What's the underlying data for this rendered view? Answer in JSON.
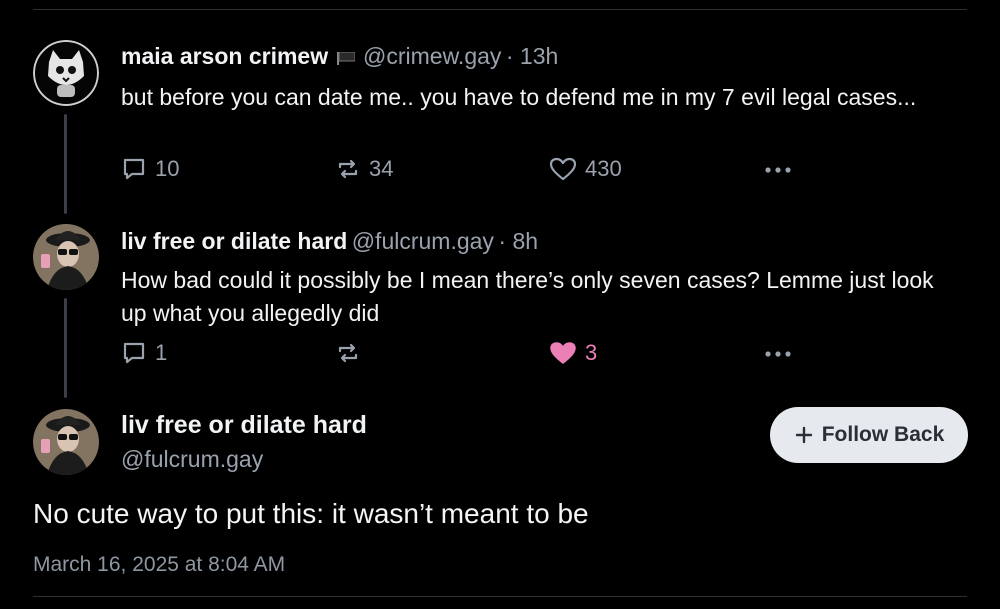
{
  "posts": [
    {
      "author_name": "maia arson crimew",
      "handle": "@crimew.gay",
      "time": "· 13h",
      "text": "but before you can date me.. you have to defend me in my 7 evil legal cases...",
      "reply_count": "10",
      "repost_count": "34",
      "like_count": "430"
    },
    {
      "author_name": "liv free or dilate hard",
      "handle": "@fulcrum.gay",
      "time": "· 8h",
      "text": "How bad could it possibly be I mean there’s only seven cases? Lemme just look up what you allegedly did",
      "reply_count": "1",
      "repost_count": "",
      "like_count": "3"
    }
  ],
  "main_post": {
    "author_name": "liv free or dilate hard",
    "handle": "@fulcrum.gay",
    "follow_label": "Follow Back",
    "text": "No cute way to put this: it wasn’t meant to be",
    "timestamp": "March 16, 2025 at 8:04 AM"
  },
  "colors": {
    "background": "#000000",
    "muted_text": "#9aa2ad",
    "liked_pink": "#ec7fb5",
    "button_bg": "#e6e9ee"
  },
  "icons": {
    "reply": "speech-bubble-icon",
    "repost": "repost-arrows-icon",
    "like": "heart-icon",
    "more": "ellipsis-icon",
    "flag": "black-flag-icon"
  }
}
